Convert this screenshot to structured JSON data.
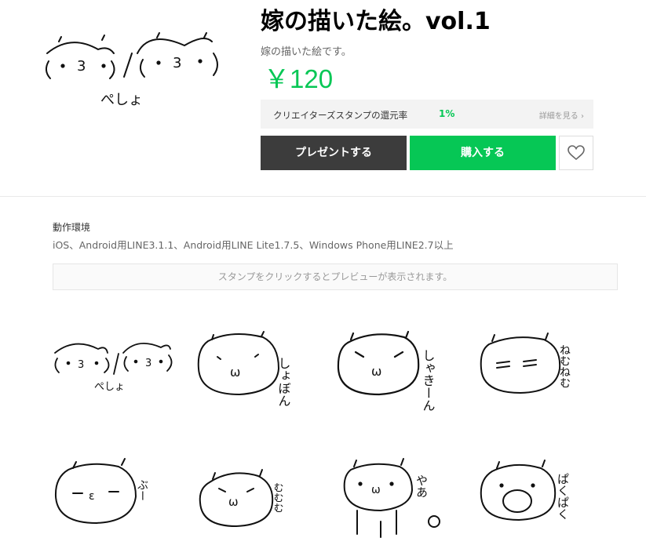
{
  "product": {
    "title": "嫁の描いた絵。vol.1",
    "author": "嫁の描いた絵です。",
    "price": "￥120"
  },
  "creator_rate": {
    "label": "クリエイターズスタンプの還元率",
    "value": "1%",
    "details_link": "詳細を見る"
  },
  "actions": {
    "gift_label": "プレゼントする",
    "buy_label": "購入する",
    "favorite_icon": "heart-icon"
  },
  "environment": {
    "heading": "動作環境",
    "text": "iOS、Android用LINE3.1.1、Android用LINE Lite1.7.5、Windows Phone用LINE2.7以上"
  },
  "preview_note": "スタンプをクリックするとプレビューが表示されます。",
  "colors": {
    "accent_green": "#06c755",
    "gift_dark": "#3c3c3c",
    "rate_background": "#f3f3f3"
  },
  "stickers": [
    {
      "caption": "ぺしょ",
      "face": "two-faces-slash"
    },
    {
      "caption": "しょぼん",
      "face": "sad"
    },
    {
      "caption": "しゃきーん",
      "face": "sharp"
    },
    {
      "caption": "ねむねむ",
      "face": "sleepy"
    },
    {
      "caption": "ぶー",
      "face": "pout"
    },
    {
      "caption": "むむむ",
      "face": "frown"
    },
    {
      "caption": "やあ",
      "face": "greeting"
    },
    {
      "caption": "ぱくぱく",
      "face": "eating"
    }
  ]
}
